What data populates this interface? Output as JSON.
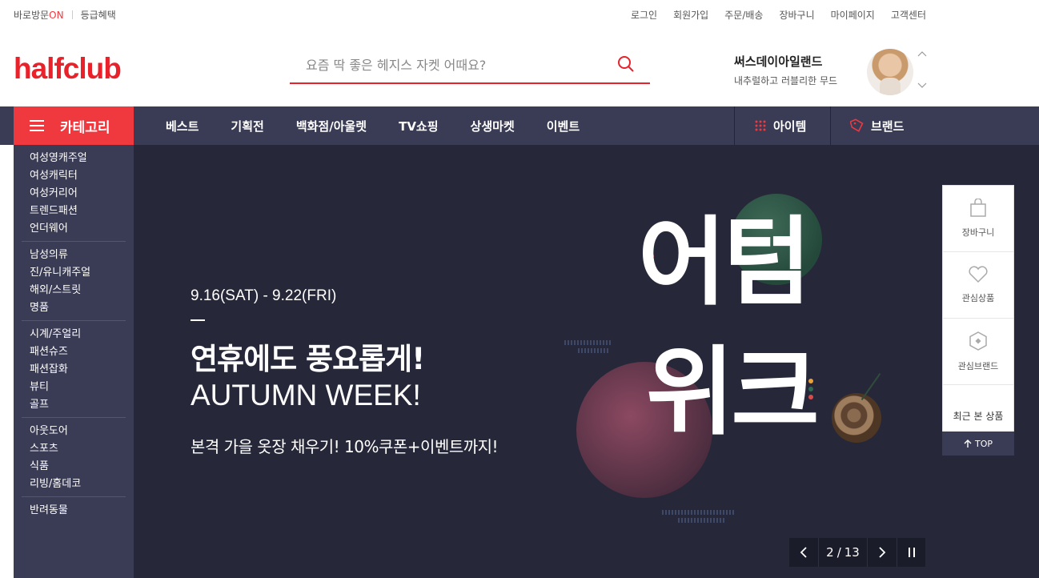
{
  "util": {
    "visit_prefix": "바로방문",
    "visit_status": "ON",
    "grade": "등급혜택",
    "links": [
      "로그인",
      "회원가입",
      "주문/배송",
      "장바구니",
      "마이페이지",
      "고객센터"
    ]
  },
  "header": {
    "logo": "halfclub",
    "search_placeholder": "요즘 딱 좋은 헤지스 자켓 어때요?",
    "promo_title": "써스데이아일랜드",
    "promo_sub": "내추럴하고 러블리한 무드"
  },
  "nav": {
    "category": "카테고리",
    "links": [
      "베스트",
      "기획전",
      "백화점/아울렛",
      "TV쇼핑",
      "상생마켓",
      "이벤트"
    ],
    "item": "아이템",
    "brand": "브랜드"
  },
  "side": {
    "groups": [
      [
        "여성영캐주얼",
        "여성캐릭터",
        "여성커리어",
        "트렌드패션",
        "언더웨어"
      ],
      [
        "남성의류",
        "진/유니캐주얼",
        "해외/스트릿",
        "명품"
      ],
      [
        "시계/주얼리",
        "패션슈즈",
        "패션잡화",
        "뷰티",
        "골프"
      ],
      [
        "아웃도어",
        "스포츠",
        "식품",
        "리빙/홈데코"
      ],
      [
        "반려동물"
      ]
    ]
  },
  "banner": {
    "date": "9.16(SAT) - 9.22(FRI)",
    "headline": "연휴에도 풍요롭게!",
    "headline_en": "AUTUMN WEEK!",
    "desc": "본격 가을 옷장 채우기! 10%쿠폰+이벤트까지!",
    "art_line1": "어텀",
    "art_line2": "위크",
    "slide_current": "2",
    "slide_sep": "/",
    "slide_total": "13"
  },
  "quick": {
    "cart": "장바구니",
    "wish": "관심상품",
    "brand": "관심브랜드",
    "recent": "최근 본 상품",
    "top": "TOP"
  },
  "colors": {
    "accent": "#f0383f",
    "nav_bg": "#3a3b55",
    "banner_bg": "#262839"
  }
}
